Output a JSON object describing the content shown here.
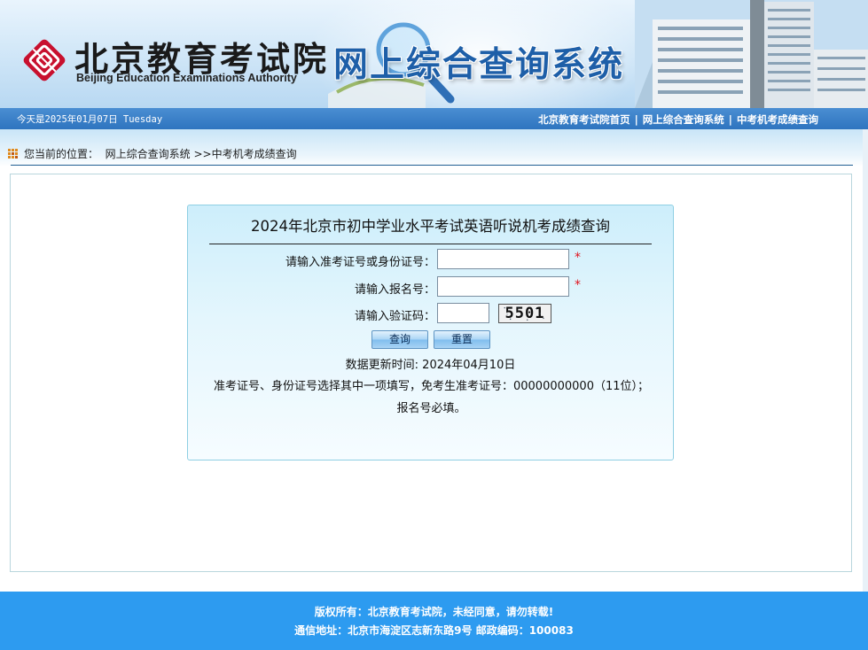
{
  "banner": {
    "logo_cn": "北京教育考试院",
    "logo_en": "Beijing Education Examinations Authority",
    "system_title": "网上综合查询系统",
    "logo_color": "#c8102e"
  },
  "navbar": {
    "date": "今天是2025年01月07日 Tuesday",
    "links": [
      "北京教育考试院首页",
      "网上综合查询系统",
      "中考机考成绩查询"
    ],
    "separator": "|"
  },
  "breadcrumb": {
    "prefix": "您当前的位置：",
    "item1": "网上综合查询系统",
    "item2": ">>中考机考成绩查询"
  },
  "query_form": {
    "title": "2024年北京市初中学业水平考试英语听说机考成绩查询",
    "fields": {
      "id_label": "请输入准考证号或身份证号：",
      "id_value": "",
      "reg_label": "请输入报名号：",
      "reg_value": "",
      "captcha_label": "请输入验证码：",
      "captcha_value": ""
    },
    "required_mark": "*",
    "captcha_text": "5501",
    "query_button": "查询",
    "reset_button": "重置",
    "update_time": "数据更新时间:  2024年04月10日",
    "note": "准考证号、身份证号选择其中一项填写，免考生准考证号：00000000000（11位）；报名号必填。"
  },
  "footer": {
    "copyright": "版权所有：北京教育考试院，未经同意，请勿转载!",
    "address": "通信地址：北京市海淀区志新东路9号 邮政编码：100083"
  },
  "colors": {
    "nav_blue": "#2e74bf",
    "title_blue": "#1e5fa8",
    "footer_blue": "#2d9bf0",
    "required_red": "#e0141e"
  }
}
